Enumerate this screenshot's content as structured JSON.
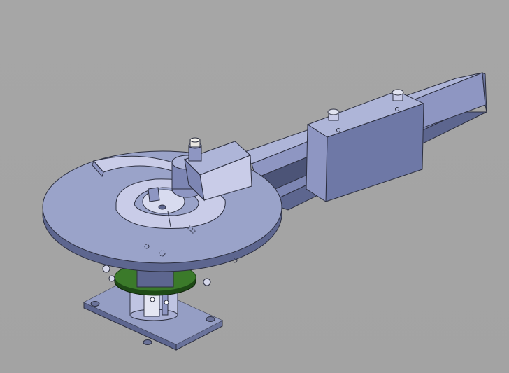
{
  "scene": {
    "background": "#a5a5a5",
    "colors": {
      "steel_light": "#c9cce8",
      "steel_mid": "#8e96c2",
      "steel_dark": "#5d668f",
      "edge": "#2c2f3f",
      "plate_top": "#9aa3c9",
      "plate_side": "#7a82a8",
      "bushing_green": "#3b7a2a",
      "bushing_green_dark": "#1e4a16",
      "pin_white": "#e8e6e0"
    },
    "parts": [
      "base-plate",
      "support-column",
      "bearing-ring",
      "bending-disc",
      "forming-die",
      "bending-arm-tube",
      "sliding-clamp-block",
      "pressure-roller-head",
      "adjustment-screw",
      "stop-bar"
    ]
  }
}
